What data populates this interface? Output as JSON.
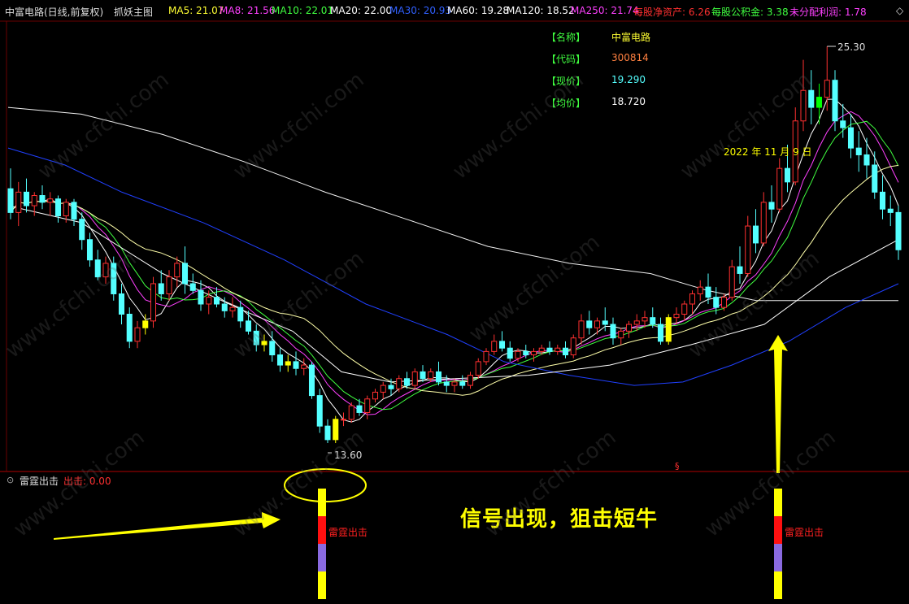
{
  "header": {
    "stock_title": "中富电路(日线,前复权)",
    "indicator_title": "抓妖主图",
    "ma": [
      {
        "label": "MA5: 21.07",
        "color": "#ffffff"
      },
      {
        "label": "MA8: 21.56",
        "color": "#ff40ff"
      },
      {
        "label": "MA10: 22.01",
        "color": "#40ff40"
      },
      {
        "label": "MA20: 22.00",
        "color": "#ffffff"
      },
      {
        "label": "MA30: 20.93",
        "color": "#3060ff"
      },
      {
        "label": "MA60: 19.28",
        "color": "#ffffff"
      },
      {
        "label": "MA120: 18.52",
        "color": "#ffffff"
      },
      {
        "label": "MA250: 21.74",
        "color": "#ff40ff"
      }
    ],
    "fundamentals": [
      {
        "label": "每股净资产: 6.26",
        "color": "#ff3030"
      },
      {
        "label": "每股公积金: 3.38",
        "color": "#40ff40"
      },
      {
        "label": "未分配利润: 1.78",
        "color": "#ff40ff"
      }
    ],
    "diamond_icon": "◇"
  },
  "info_box": {
    "name_label": "【名称】",
    "name_value": "中富电路",
    "code_label": "【代码】",
    "code_value": "300814",
    "price_label": "【现价】",
    "price_value": "19.290",
    "avg_label": "【均价】",
    "avg_value": "18.720"
  },
  "annotations": {
    "date_label": "2022 年 11 月 9 日",
    "high_label": "25.30",
    "low_label": "13.60",
    "slogan": "信号出现，狙击短牛",
    "section_mark": "§"
  },
  "sub_panel": {
    "title": "雷霆出击",
    "value_label": "出击: 0.00",
    "signal_label_1": "雷霆出击",
    "signal_label_2": "雷霆出击"
  },
  "watermark": "www.cfchi.com",
  "colors": {
    "up": "#ff3030",
    "down": "#54ffff",
    "highlight": "#ffff00",
    "signal_green": "#00ff00",
    "ma5": "#ffffff",
    "ma8": "#ff40ff",
    "ma10": "#40ff40",
    "ma20": "#ffffaa",
    "ma30": "#2040ff",
    "ma60": "#ffffff",
    "ma120": "#f0f0f0",
    "grid": "#8b0000"
  },
  "chart_data": {
    "type": "candlestick",
    "price_range": [
      13.6,
      25.3
    ],
    "period": "日线",
    "adjustment": "前复权",
    "candles": [
      {
        "o": 21.1,
        "h": 21.7,
        "l": 20.2,
        "c": 20.4
      },
      {
        "o": 20.4,
        "h": 21.3,
        "l": 20.0,
        "c": 21.0
      },
      {
        "o": 21.0,
        "h": 21.4,
        "l": 20.4,
        "c": 20.6
      },
      {
        "o": 20.6,
        "h": 21.0,
        "l": 20.3,
        "c": 20.9
      },
      {
        "o": 20.9,
        "h": 21.2,
        "l": 20.5,
        "c": 20.7
      },
      {
        "o": 20.7,
        "h": 21.0,
        "l": 20.3,
        "c": 20.8
      },
      {
        "o": 20.8,
        "h": 20.9,
        "l": 20.1,
        "c": 20.3
      },
      {
        "o": 20.3,
        "h": 20.8,
        "l": 20.1,
        "c": 20.7
      },
      {
        "o": 20.7,
        "h": 20.8,
        "l": 20.0,
        "c": 20.2
      },
      {
        "o": 20.2,
        "h": 20.4,
        "l": 19.3,
        "c": 19.6
      },
      {
        "o": 19.6,
        "h": 19.8,
        "l": 18.8,
        "c": 19.0
      },
      {
        "o": 19.0,
        "h": 19.3,
        "l": 18.4,
        "c": 18.5
      },
      {
        "o": 18.5,
        "h": 19.1,
        "l": 18.3,
        "c": 18.9
      },
      {
        "o": 18.9,
        "h": 19.1,
        "l": 17.8,
        "c": 18.0
      },
      {
        "o": 18.0,
        "h": 18.3,
        "l": 17.1,
        "c": 17.4
      },
      {
        "o": 17.4,
        "h": 17.6,
        "l": 16.4,
        "c": 16.6
      },
      {
        "o": 16.6,
        "h": 17.2,
        "l": 16.4,
        "c": 17.0
      },
      {
        "o": 17.0,
        "h": 17.4,
        "l": 16.8,
        "c": 17.2,
        "hl": 1
      },
      {
        "o": 17.2,
        "h": 18.5,
        "l": 17.0,
        "c": 18.3
      },
      {
        "o": 18.3,
        "h": 18.7,
        "l": 17.8,
        "c": 18.0
      },
      {
        "o": 18.0,
        "h": 18.7,
        "l": 17.8,
        "c": 18.5
      },
      {
        "o": 18.5,
        "h": 19.1,
        "l": 18.2,
        "c": 18.9
      },
      {
        "o": 18.9,
        "h": 19.4,
        "l": 18.0,
        "c": 18.3
      },
      {
        "o": 18.3,
        "h": 18.6,
        "l": 18.0,
        "c": 18.1
      },
      {
        "o": 18.1,
        "h": 18.4,
        "l": 17.5,
        "c": 17.7
      },
      {
        "o": 17.7,
        "h": 18.1,
        "l": 17.4,
        "c": 17.9
      },
      {
        "o": 17.9,
        "h": 18.2,
        "l": 17.6,
        "c": 17.7
      },
      {
        "o": 17.7,
        "h": 17.9,
        "l": 17.3,
        "c": 17.5
      },
      {
        "o": 17.5,
        "h": 17.9,
        "l": 17.3,
        "c": 17.6
      },
      {
        "o": 17.6,
        "h": 17.8,
        "l": 17.0,
        "c": 17.2
      },
      {
        "o": 17.2,
        "h": 17.5,
        "l": 16.8,
        "c": 16.9
      },
      {
        "o": 16.9,
        "h": 17.1,
        "l": 16.3,
        "c": 16.5
      },
      {
        "o": 16.5,
        "h": 16.8,
        "l": 16.3,
        "c": 16.6,
        "hl": 1
      },
      {
        "o": 16.6,
        "h": 16.9,
        "l": 16.0,
        "c": 16.2
      },
      {
        "o": 16.2,
        "h": 16.4,
        "l": 15.7,
        "c": 15.9
      },
      {
        "o": 15.9,
        "h": 16.2,
        "l": 15.7,
        "c": 16.0,
        "hl": 1
      },
      {
        "o": 16.0,
        "h": 16.3,
        "l": 15.6,
        "c": 15.8
      },
      {
        "o": 15.8,
        "h": 16.1,
        "l": 15.6,
        "c": 15.9
      },
      {
        "o": 15.9,
        "h": 16.0,
        "l": 14.9,
        "c": 15.0
      },
      {
        "o": 15.0,
        "h": 15.2,
        "l": 13.9,
        "c": 14.1
      },
      {
        "o": 14.1,
        "h": 14.3,
        "l": 13.6,
        "c": 13.7
      },
      {
        "o": 13.7,
        "h": 14.4,
        "l": 13.6,
        "c": 14.3,
        "hl": 1
      },
      {
        "o": 14.3,
        "h": 14.5,
        "l": 14.1,
        "c": 14.3
      },
      {
        "o": 14.3,
        "h": 14.8,
        "l": 14.2,
        "c": 14.7
      },
      {
        "o": 14.7,
        "h": 14.9,
        "l": 14.4,
        "c": 14.5
      },
      {
        "o": 14.5,
        "h": 15.0,
        "l": 14.3,
        "c": 14.9
      },
      {
        "o": 14.9,
        "h": 15.2,
        "l": 14.8,
        "c": 15.1
      },
      {
        "o": 15.1,
        "h": 15.4,
        "l": 14.9,
        "c": 15.3
      },
      {
        "o": 15.3,
        "h": 15.5,
        "l": 15.0,
        "c": 15.2
      },
      {
        "o": 15.2,
        "h": 15.6,
        "l": 15.1,
        "c": 15.5
      },
      {
        "o": 15.5,
        "h": 15.7,
        "l": 15.2,
        "c": 15.3
      },
      {
        "o": 15.3,
        "h": 15.8,
        "l": 15.2,
        "c": 15.7
      },
      {
        "o": 15.7,
        "h": 15.9,
        "l": 15.4,
        "c": 15.5
      },
      {
        "o": 15.5,
        "h": 15.8,
        "l": 15.4,
        "c": 15.7
      },
      {
        "o": 15.7,
        "h": 16.0,
        "l": 15.3,
        "c": 15.4
      },
      {
        "o": 15.4,
        "h": 15.6,
        "l": 15.1,
        "c": 15.3
      },
      {
        "o": 15.3,
        "h": 15.5,
        "l": 15.1,
        "c": 15.4
      },
      {
        "o": 15.4,
        "h": 15.6,
        "l": 15.2,
        "c": 15.3
      },
      {
        "o": 15.3,
        "h": 15.7,
        "l": 15.2,
        "c": 15.6
      },
      {
        "o": 15.6,
        "h": 16.1,
        "l": 15.5,
        "c": 16.0
      },
      {
        "o": 16.0,
        "h": 16.4,
        "l": 15.9,
        "c": 16.3
      },
      {
        "o": 16.3,
        "h": 16.8,
        "l": 16.2,
        "c": 16.6
      },
      {
        "o": 16.6,
        "h": 16.9,
        "l": 16.3,
        "c": 16.4
      },
      {
        "o": 16.4,
        "h": 16.6,
        "l": 16.0,
        "c": 16.1
      },
      {
        "o": 16.1,
        "h": 16.4,
        "l": 16.0,
        "c": 16.3
      },
      {
        "o": 16.3,
        "h": 16.5,
        "l": 16.1,
        "c": 16.2
      },
      {
        "o": 16.2,
        "h": 16.4,
        "l": 16.0,
        "c": 16.3
      },
      {
        "o": 16.3,
        "h": 16.5,
        "l": 16.2,
        "c": 16.4
      },
      {
        "o": 16.4,
        "h": 16.6,
        "l": 16.2,
        "c": 16.3
      },
      {
        "o": 16.3,
        "h": 16.5,
        "l": 16.2,
        "c": 16.4
      },
      {
        "o": 16.4,
        "h": 16.6,
        "l": 16.1,
        "c": 16.2
      },
      {
        "o": 16.2,
        "h": 16.8,
        "l": 16.1,
        "c": 16.7
      },
      {
        "o": 16.7,
        "h": 17.4,
        "l": 16.5,
        "c": 17.2
      },
      {
        "o": 17.2,
        "h": 17.5,
        "l": 16.8,
        "c": 17.0
      },
      {
        "o": 17.0,
        "h": 17.3,
        "l": 16.8,
        "c": 17.2
      },
      {
        "o": 17.2,
        "h": 17.6,
        "l": 16.9,
        "c": 17.1
      },
      {
        "o": 17.1,
        "h": 17.3,
        "l": 16.5,
        "c": 16.7
      },
      {
        "o": 16.7,
        "h": 17.0,
        "l": 16.5,
        "c": 16.9
      },
      {
        "o": 16.9,
        "h": 17.2,
        "l": 16.7,
        "c": 17.1
      },
      {
        "o": 17.1,
        "h": 17.4,
        "l": 16.9,
        "c": 17.2
      },
      {
        "o": 17.2,
        "h": 17.5,
        "l": 17.0,
        "c": 17.3
      },
      {
        "o": 17.3,
        "h": 17.6,
        "l": 17.0,
        "c": 17.1
      },
      {
        "o": 17.1,
        "h": 17.3,
        "l": 16.5,
        "c": 16.6
      },
      {
        "o": 16.6,
        "h": 17.4,
        "l": 16.5,
        "c": 17.3,
        "hl": 1
      },
      {
        "o": 17.3,
        "h": 17.6,
        "l": 17.1,
        "c": 17.4
      },
      {
        "o": 17.4,
        "h": 17.8,
        "l": 17.2,
        "c": 17.7
      },
      {
        "o": 17.7,
        "h": 18.1,
        "l": 17.4,
        "c": 18.0
      },
      {
        "o": 18.0,
        "h": 18.4,
        "l": 17.8,
        "c": 18.2
      },
      {
        "o": 18.2,
        "h": 18.6,
        "l": 17.7,
        "c": 17.9
      },
      {
        "o": 17.9,
        "h": 18.2,
        "l": 17.4,
        "c": 17.6
      },
      {
        "o": 17.6,
        "h": 18.0,
        "l": 17.5,
        "c": 17.9
      },
      {
        "o": 17.9,
        "h": 19.0,
        "l": 17.8,
        "c": 18.8
      },
      {
        "o": 18.8,
        "h": 19.4,
        "l": 18.3,
        "c": 18.6
      },
      {
        "o": 18.6,
        "h": 20.3,
        "l": 18.5,
        "c": 20.0
      },
      {
        "o": 20.0,
        "h": 20.5,
        "l": 19.2,
        "c": 19.5
      },
      {
        "o": 19.5,
        "h": 21.0,
        "l": 19.4,
        "c": 20.7
      },
      {
        "o": 20.7,
        "h": 21.2,
        "l": 20.1,
        "c": 20.5
      },
      {
        "o": 20.5,
        "h": 22.0,
        "l": 20.4,
        "c": 21.7
      },
      {
        "o": 21.7,
        "h": 22.4,
        "l": 21.0,
        "c": 21.3
      },
      {
        "o": 21.3,
        "h": 23.5,
        "l": 21.2,
        "c": 23.1
      },
      {
        "o": 23.1,
        "h": 24.9,
        "l": 22.8,
        "c": 24.0
      },
      {
        "o": 24.0,
        "h": 24.6,
        "l": 23.0,
        "c": 23.5
      },
      {
        "o": 23.5,
        "h": 24.2,
        "l": 23.0,
        "c": 23.8,
        "g": 1
      },
      {
        "o": 23.8,
        "h": 25.3,
        "l": 23.4,
        "c": 24.3
      },
      {
        "o": 24.3,
        "h": 24.6,
        "l": 22.8,
        "c": 23.1
      },
      {
        "o": 23.1,
        "h": 23.6,
        "l": 22.6,
        "c": 22.9
      },
      {
        "o": 22.9,
        "h": 23.3,
        "l": 22.0,
        "c": 22.3
      },
      {
        "o": 22.3,
        "h": 22.8,
        "l": 21.6,
        "c": 22.1
      },
      {
        "o": 22.1,
        "h": 22.6,
        "l": 21.4,
        "c": 21.8
      },
      {
        "o": 21.8,
        "h": 22.2,
        "l": 20.8,
        "c": 21.0
      },
      {
        "o": 21.0,
        "h": 21.5,
        "l": 20.2,
        "c": 20.5
      },
      {
        "o": 20.5,
        "h": 20.9,
        "l": 20.0,
        "c": 20.4
      },
      {
        "o": 20.4,
        "h": 20.6,
        "l": 19.0,
        "c": 19.3
      }
    ]
  }
}
